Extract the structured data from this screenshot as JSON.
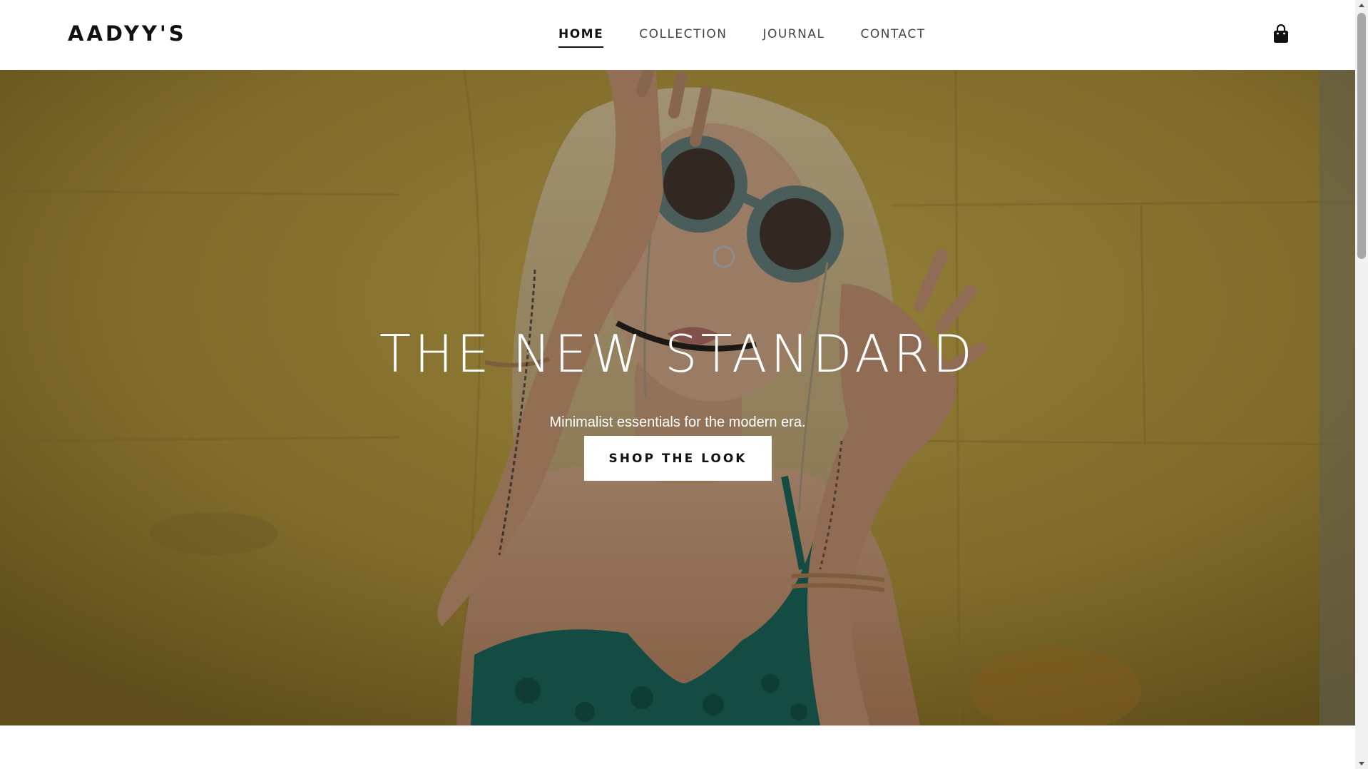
{
  "brand": {
    "logo": "AADYY'S"
  },
  "nav": {
    "items": [
      {
        "label": "HOME",
        "active": true
      },
      {
        "label": "COLLECTION",
        "active": false
      },
      {
        "label": "JOURNAL",
        "active": false
      },
      {
        "label": "CONTACT",
        "active": false
      }
    ]
  },
  "header": {
    "cart_icon": "shopping-bag-icon"
  },
  "hero": {
    "title": "THE NEW STANDARD",
    "subtitle": "Minimalist essentials for the modern era.",
    "cta_label": "SHOP THE LOOK",
    "image": "woman-with-round-sunglasses-against-yellow-wall"
  },
  "colors": {
    "background": "#ffffff",
    "text_dark": "#111111",
    "hero_wall": "#b69a3a",
    "hero_overlay": "rgba(0,0,0,0.32)",
    "button_bg": "#ffffff"
  }
}
